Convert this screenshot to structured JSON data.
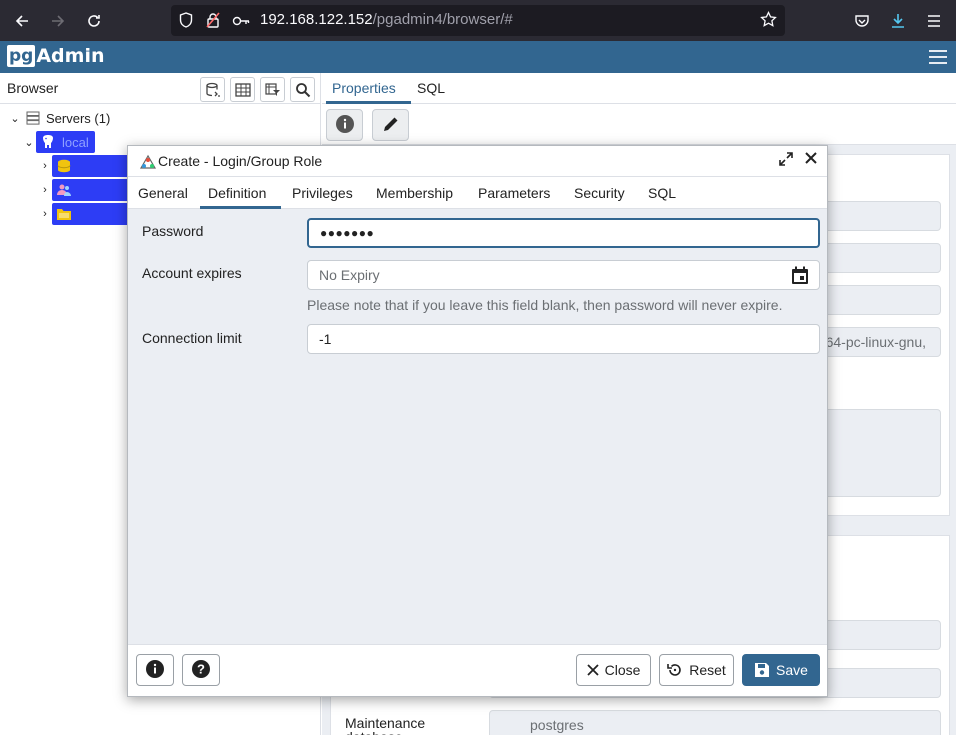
{
  "browser_chrome": {
    "url_host": "192.168.122.152",
    "url_path": "/pgadmin4/browser/#"
  },
  "app": {
    "logo_pg": "pg",
    "logo_admin": "Admin"
  },
  "browser_panel": {
    "title": "Browser",
    "tree": {
      "servers_label": "Servers (1)",
      "server_label": "local"
    }
  },
  "properties_panel": {
    "tabs": [
      "Properties",
      "SQL"
    ],
    "ghost": {
      "partial_value": "64-pc-linux-gnu,",
      "maintenance_label_1": "Maintenance",
      "maintenance_label_2": "database",
      "maintenance_value": "postgres"
    }
  },
  "dialog": {
    "title": "Create - Login/Group Role",
    "tabs": [
      "General",
      "Definition",
      "Privileges",
      "Membership",
      "Parameters",
      "Security",
      "SQL"
    ],
    "active_tab": "Definition",
    "fields": {
      "password_label": "Password",
      "password_value": "●●●●●●●",
      "expires_label": "Account expires",
      "expires_placeholder": "No Expiry",
      "expires_help": "Please note that if you leave this field blank, then password will never expire.",
      "connlimit_label": "Connection limit",
      "connlimit_value": "-1"
    },
    "footer": {
      "close_label": "Close",
      "reset_label": "Reset",
      "save_label": "Save"
    }
  },
  "colors": {
    "brand": "#326690",
    "tree_highlight": "#2d3df5"
  }
}
